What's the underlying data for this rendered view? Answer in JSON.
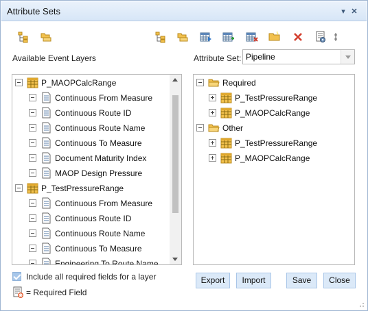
{
  "window": {
    "title": "Attribute Sets"
  },
  "titlebar": {
    "dropdown_glyph": "▾",
    "close_glyph": "✕"
  },
  "toolbar": {
    "left_icons": [
      "add-layer-icon",
      "add-folder-icon"
    ],
    "right_icons": [
      "add-layer-icon",
      "add-folder-icon",
      "table-import-icon",
      "add-field-icon",
      "remove-field-icon",
      "new-folder-icon",
      "delete-icon",
      "properties-icon",
      "more-icon"
    ]
  },
  "left": {
    "heading": "Available Event Layers",
    "rows": [
      {
        "level": 0,
        "kind": "layer",
        "label": "P_MAOPCalcRange"
      },
      {
        "level": 1,
        "kind": "field",
        "label": "Continuous From Measure"
      },
      {
        "level": 1,
        "kind": "field",
        "label": "Continuous Route ID"
      },
      {
        "level": 1,
        "kind": "field",
        "label": "Continuous Route Name"
      },
      {
        "level": 1,
        "kind": "field",
        "label": "Continuous To Measure"
      },
      {
        "level": 1,
        "kind": "field",
        "label": "Document Maturity Index"
      },
      {
        "level": 1,
        "kind": "field",
        "label": "MAOP Design Pressure"
      },
      {
        "level": 0,
        "kind": "layer",
        "label": "P_TestPressureRange"
      },
      {
        "level": 1,
        "kind": "field",
        "label": "Continuous From Measure"
      },
      {
        "level": 1,
        "kind": "field",
        "label": "Continuous Route ID"
      },
      {
        "level": 1,
        "kind": "field",
        "label": "Continuous Route Name"
      },
      {
        "level": 1,
        "kind": "field",
        "label": "Continuous To Measure"
      },
      {
        "level": 1,
        "kind": "field",
        "label": "Engineering To Route Name"
      }
    ]
  },
  "right": {
    "set_label": "Attribute Set:",
    "set_value": "Pipeline",
    "rows": [
      {
        "level": 0,
        "kind": "folder",
        "expander": "minus",
        "label": "Required"
      },
      {
        "level": 1,
        "kind": "layer",
        "expander": "plus",
        "label": "P_TestPressureRange"
      },
      {
        "level": 1,
        "kind": "layer",
        "expander": "plus",
        "label": "P_MAOPCalcRange"
      },
      {
        "level": 0,
        "kind": "folder",
        "expander": "minus",
        "label": "Other"
      },
      {
        "level": 1,
        "kind": "layer",
        "expander": "plus",
        "label": "P_TestPressureRange"
      },
      {
        "level": 1,
        "kind": "layer",
        "expander": "plus",
        "label": "P_MAOPCalcRange"
      }
    ]
  },
  "options": {
    "include_required_label": "Include all required fields for a layer",
    "include_required_checked": true,
    "legend_label": "= Required Field"
  },
  "buttons": {
    "export": "Export",
    "import": "Import",
    "save": "Save",
    "close": "Close"
  },
  "colors": {
    "accent": "#a9c6e8",
    "titlebar": "#dbe9f8",
    "folder": "#f2c14e",
    "layer": "#e0a82e"
  }
}
